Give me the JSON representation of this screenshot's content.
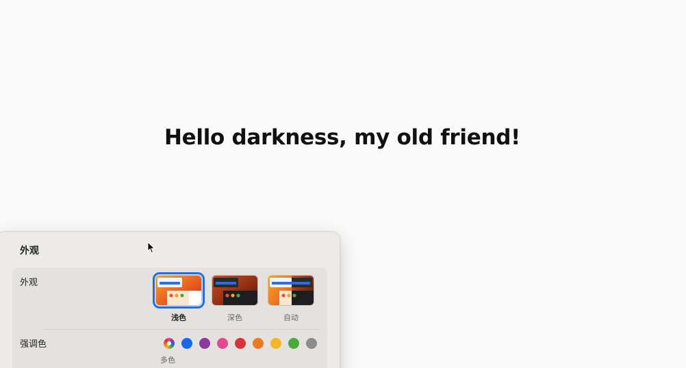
{
  "hero": {
    "text": "Hello darkness, my old friend!"
  },
  "panel": {
    "title": "外观",
    "appearance": {
      "label": "外观",
      "options": [
        {
          "label": "浅色",
          "selected": true
        },
        {
          "label": "深色",
          "selected": false
        },
        {
          "label": "自动",
          "selected": false
        }
      ]
    },
    "accent": {
      "label": "强调色",
      "selected_label": "多色",
      "colors": [
        {
          "name": "multicolor",
          "hex": "conic"
        },
        {
          "name": "blue",
          "hex": "#1769e9"
        },
        {
          "name": "purple",
          "hex": "#8a3a9e"
        },
        {
          "name": "pink",
          "hex": "#e4488f"
        },
        {
          "name": "red",
          "hex": "#d6333a"
        },
        {
          "name": "orange",
          "hex": "#ec7a1f"
        },
        {
          "name": "yellow",
          "hex": "#f4b623"
        },
        {
          "name": "green",
          "hex": "#4aa93d"
        },
        {
          "name": "graphite",
          "hex": "#8c8c8c"
        }
      ]
    }
  },
  "colors": {
    "accent": "#1a6ff0",
    "background": "#fafafa",
    "panel": "#ecebe8"
  }
}
